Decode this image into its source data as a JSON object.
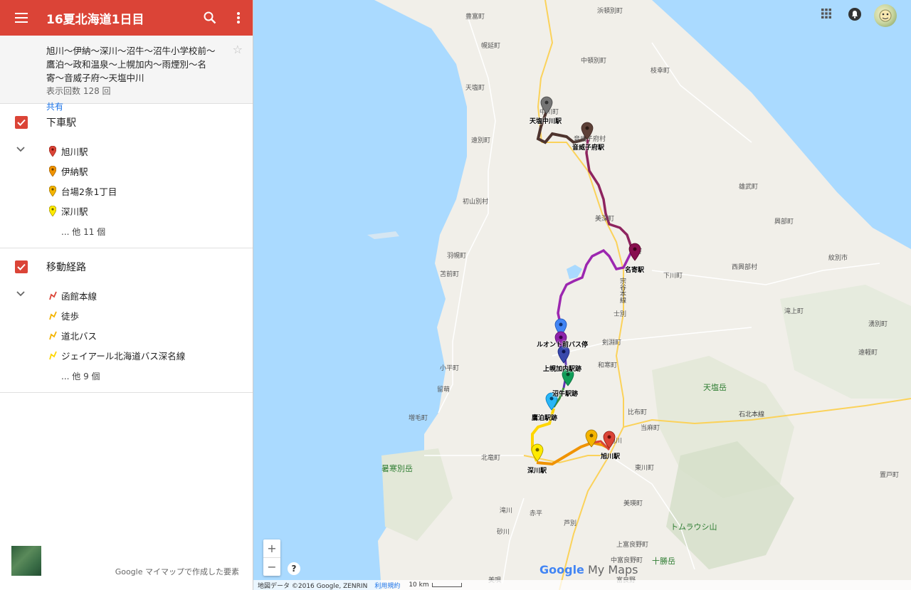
{
  "header": {
    "title": "16夏北海道1日目"
  },
  "description": {
    "text": "旭川〜伊納〜深川〜沼牛〜沼牛小学校前〜鷹泊〜政和温泉〜上幌加内〜雨煙別〜名寄〜音威子府〜天塩中川",
    "views": "表示回数 128 回",
    "share": "共有"
  },
  "layers": [
    {
      "title": "下車駅",
      "items": [
        {
          "label": "旭川駅",
          "color": "#db4437",
          "icon": "marker-icon"
        },
        {
          "label": "伊納駅",
          "color": "#f09300",
          "icon": "marker-icon"
        },
        {
          "label": "台場2条1丁目",
          "color": "#f4b400",
          "icon": "marker-icon"
        },
        {
          "label": "深川駅",
          "color": "#ffea00",
          "icon": "marker-icon"
        }
      ],
      "more": "... 他 11 個"
    },
    {
      "title": "移動経路",
      "items": [
        {
          "label": "函館本線",
          "color": "#db4437",
          "icon": "route-icon"
        },
        {
          "label": "徒歩",
          "color": "#f4b400",
          "icon": "route-icon"
        },
        {
          "label": "道北バス",
          "color": "#f4b400",
          "icon": "route-icon"
        },
        {
          "label": "ジェイアール北海道バス深名線",
          "color": "#ffea00",
          "icon": "route-icon"
        }
      ],
      "more": "... 他 9 個"
    }
  ],
  "footer": {
    "credit": "Google マイマップで作成した要素"
  },
  "map": {
    "stations": [
      "天塩中川駅",
      "音威子府駅",
      "名寄駅",
      "ルオント前バス停",
      "上幌加内駅跡",
      "沼牛駅跡",
      "鷹泊駅跡",
      "深川駅",
      "旭川駅"
    ],
    "places": [
      "浜頓別町",
      "豊富町",
      "幌延町",
      "中頓別町",
      "枝幸町",
      "天塩町",
      "中川町",
      "遠別町",
      "音威子府村",
      "初山別村",
      "美深町",
      "雄武町",
      "興部町",
      "紋別市",
      "羽幌町",
      "苫前町",
      "名寄",
      "下川町",
      "西興部村",
      "士別",
      "滝上町",
      "湧別町",
      "剣淵町",
      "和寒町",
      "遠軽町",
      "小平町",
      "留萌",
      "比布町",
      "増毛町",
      "当麻町",
      "北竜町",
      "旭川",
      "東川町",
      "美瑛町",
      "滝川",
      "赤平",
      "砂川",
      "芦別",
      "上富良野町",
      "中富良野町",
      "美唄",
      "富良野",
      "置戸町"
    ],
    "mountains": [
      "天塩岳",
      "暑寒別岳",
      "トムラウシ山",
      "十勝岳"
    ],
    "roads": [
      "石北本線",
      "宗谷本線"
    ],
    "zoom_in": "+",
    "zoom_out": "−",
    "help": "?",
    "brand_google": "Google",
    "brand_mymaps": "My Maps",
    "attribution": "地図データ ©2016 Google, ZENRIN",
    "terms": "利用規約",
    "scale": "10 km"
  }
}
